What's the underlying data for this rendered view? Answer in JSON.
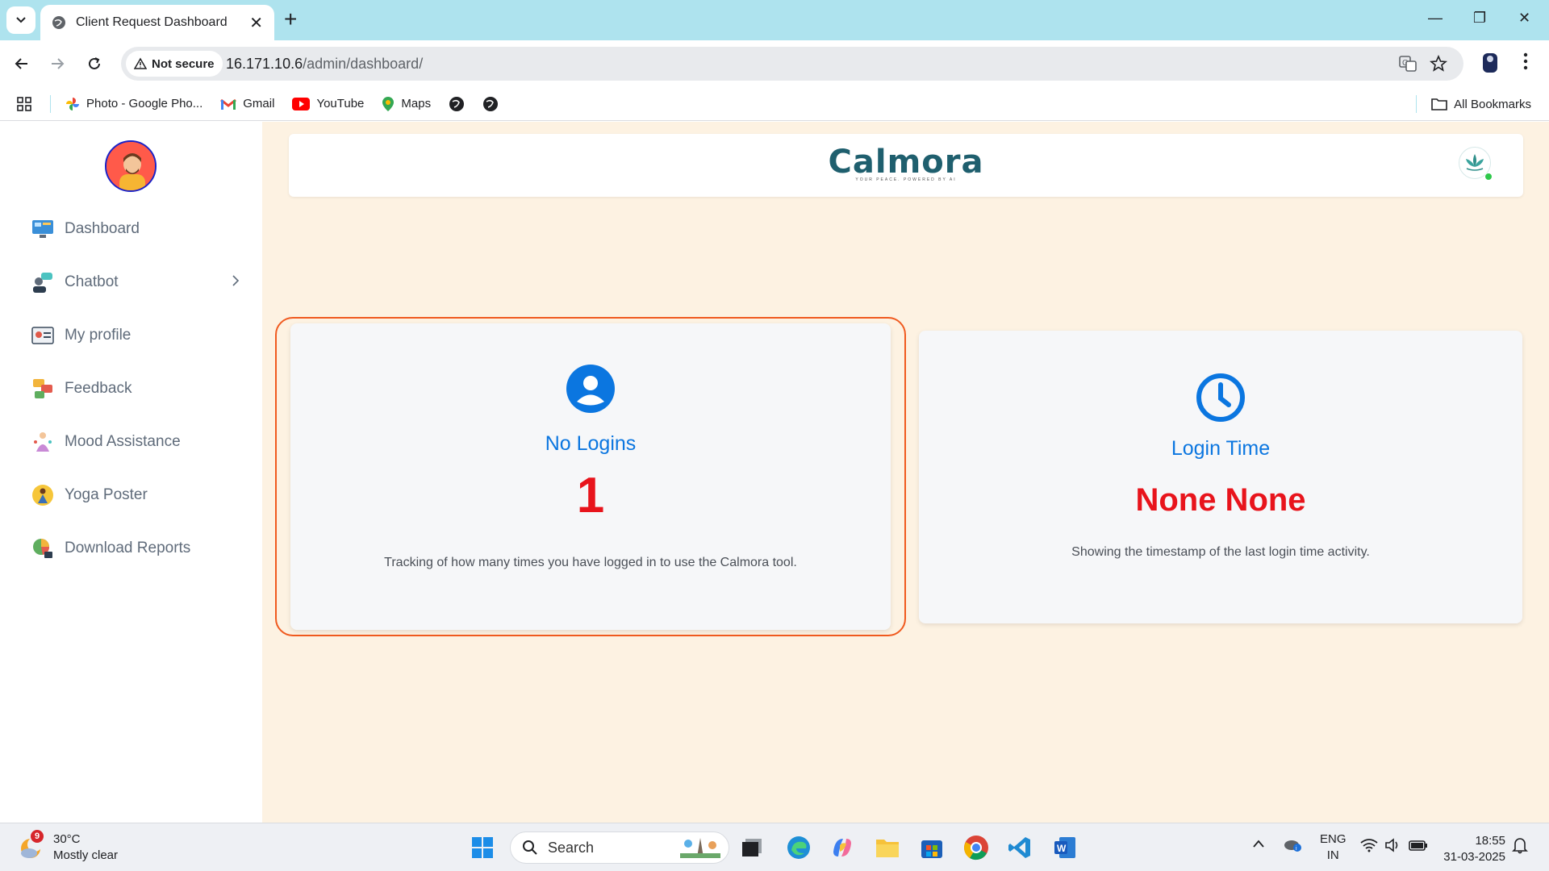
{
  "browser": {
    "tab_title": "Client Request Dashboard",
    "security_label": "Not secure",
    "url_host": "16.171.10.6",
    "url_path": "/admin/dashboard/",
    "bookmarks": [
      {
        "label": "Photo - Google Pho...",
        "icon": "google-photos-icon"
      },
      {
        "label": "Gmail",
        "icon": "gmail-icon"
      },
      {
        "label": "YouTube",
        "icon": "youtube-icon"
      },
      {
        "label": "Maps",
        "icon": "maps-icon"
      }
    ],
    "all_bookmarks_label": "All Bookmarks"
  },
  "sidebar": {
    "items": [
      {
        "label": "Dashboard",
        "icon": "dashboard-icon"
      },
      {
        "label": "Chatbot",
        "icon": "chatbot-icon"
      },
      {
        "label": "My profile",
        "icon": "profile-icon"
      },
      {
        "label": "Feedback",
        "icon": "feedback-icon"
      },
      {
        "label": "Mood Assistance",
        "icon": "mood-icon"
      },
      {
        "label": "Yoga Poster",
        "icon": "yoga-icon"
      },
      {
        "label": "Download Reports",
        "icon": "reports-icon"
      }
    ]
  },
  "header": {
    "brand": "Calmora",
    "tagline": "YOUR PEACE. POWERED BY AI"
  },
  "cards": {
    "logins": {
      "title": "No Logins",
      "value": "1",
      "description": "Tracking of how many times you have logged in to use the Calmora tool."
    },
    "login_time": {
      "title": "Login Time",
      "value": "None None",
      "description": "Showing the timestamp of the last login time activity."
    }
  },
  "taskbar": {
    "weather_temp": "30°C",
    "weather_desc": "Mostly clear",
    "weather_badge": "9",
    "search_label": "Search",
    "lang_top": "ENG",
    "lang_bottom": "IN",
    "time": "18:55",
    "date": "31-03-2025"
  },
  "colors": {
    "accent": "#0b76e0",
    "value_red": "#e8141c",
    "highlight": "#f05a1f",
    "app_bg": "#fdf2e2",
    "tabstrip": "#aee3ee",
    "brand": "#1f5f6e"
  }
}
